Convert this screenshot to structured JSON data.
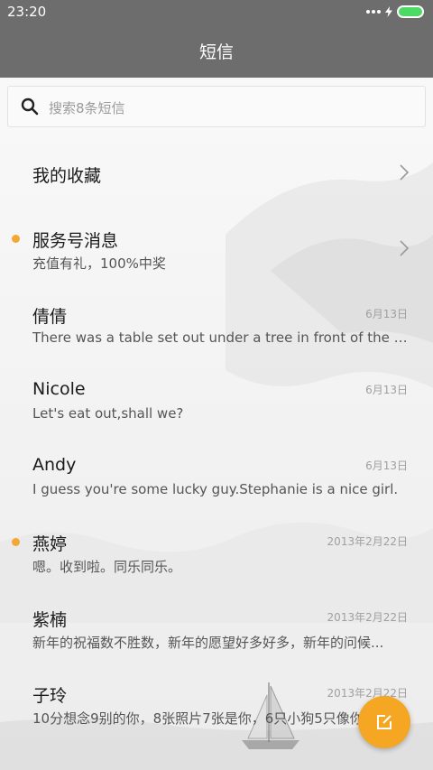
{
  "status_bar": {
    "time": "23:20"
  },
  "header": {
    "title": "短信"
  },
  "search": {
    "placeholder": "搜索8条短信"
  },
  "conversations": [
    {
      "name": "我的收藏",
      "preview": "",
      "date": "",
      "unread": false,
      "chevron": true
    },
    {
      "name": "服务号消息",
      "preview": "充值有礼，100%中奖",
      "date": "",
      "unread": true,
      "chevron": true
    },
    {
      "name": "倩倩",
      "preview": "There was a table set out under a tree in front of the ho...",
      "date": "6月13日",
      "unread": false,
      "chevron": false
    },
    {
      "name": "Nicole",
      "preview": "Let's eat out,shall we?",
      "date": "6月13日",
      "unread": false,
      "chevron": false
    },
    {
      "name": "Andy",
      "preview": "I guess you're some lucky guy.Stephanie is a nice girl.",
      "date": "6月13日",
      "unread": false,
      "chevron": false
    },
    {
      "name": "燕婷",
      "preview": "嗯。收到啦。同乐同乐。",
      "date": "2013年2月22日",
      "unread": true,
      "chevron": false
    },
    {
      "name": "紫楠",
      "preview": "新年的祝福数不胜数，新年的愿望好多好多，新年的问候...",
      "date": "2013年2月22日",
      "unread": false,
      "chevron": false
    },
    {
      "name": "子玲",
      "preview": "10分想念9别的你，8张照片7张是你，6只小狗5只像你",
      "date": "2013年2月22日",
      "unread": false,
      "chevron": false
    }
  ],
  "icons": {
    "search": "search-icon",
    "chevron": "chevron-right-icon",
    "compose": "compose-icon",
    "unread": "unread-dot-icon",
    "signal": "signal-icon",
    "charging": "charging-icon",
    "battery": "battery-icon"
  },
  "colors": {
    "header": "#6d6d6d",
    "accent": "#f5a623",
    "battery": "#4cd964"
  }
}
